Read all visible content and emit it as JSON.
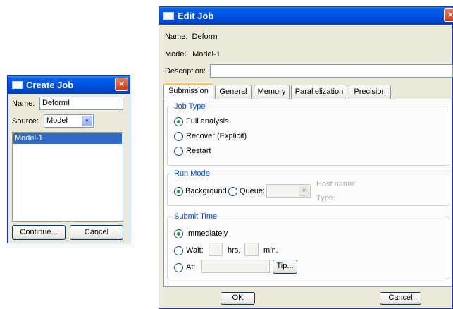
{
  "create_job": {
    "title": "Create Job",
    "close": "×",
    "name_label": "Name:",
    "name_value": "Deform",
    "source_label": "Source:",
    "source_value": "Model",
    "models": [
      "Model-1"
    ],
    "continue_label": "Continue...",
    "cancel_label": "Cancel"
  },
  "edit_job": {
    "title": "Edit Job",
    "close": "×",
    "name_line": "Name:  Deform",
    "model_line": "Model:  Model-1",
    "description_label": "Description:",
    "description_value": "",
    "tabs": [
      "Submission",
      "General",
      "Memory",
      "Parallelization",
      "Precision"
    ],
    "active_tab": "Submission",
    "job_type": {
      "label": "Job Type",
      "options": [
        "Full analysis",
        "Recover (Explicit)",
        "Restart"
      ],
      "selected": "Full analysis"
    },
    "run_mode": {
      "label": "Run Mode",
      "background": "Background",
      "queue": "Queue:",
      "host_name": "Host name:",
      "type": "Type:",
      "selected": "Background"
    },
    "submit_time": {
      "label": "Submit Time",
      "immediately": "Immediately",
      "wait": "Wait:",
      "hrs": "hrs.",
      "min": "min.",
      "at": "At:",
      "tip": "Tip...",
      "selected": "Immediately"
    },
    "ok_label": "OK",
    "cancel_label": "Cancel"
  },
  "colors": {
    "titlebar": "#0054e3",
    "selection": "#316ac5",
    "group_label": "#0046d5",
    "radio_dot": "#21a121"
  }
}
